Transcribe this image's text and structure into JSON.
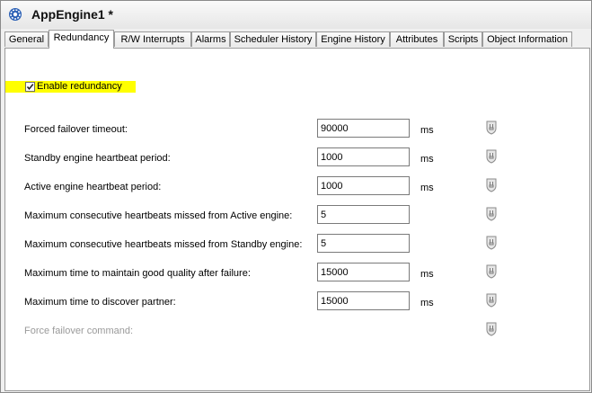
{
  "window": {
    "title": "AppEngine1 *",
    "icon": "engine-gear-icon"
  },
  "tabs": [
    {
      "label": "General",
      "active": false
    },
    {
      "label": "Redundancy",
      "active": true
    },
    {
      "label": "R/W Interrupts",
      "active": false
    },
    {
      "label": "Alarms",
      "active": false
    },
    {
      "label": "Scheduler History",
      "active": false
    },
    {
      "label": "Engine History",
      "active": false
    },
    {
      "label": "Attributes",
      "active": false
    },
    {
      "label": "Scripts",
      "active": false
    },
    {
      "label": "Object Information",
      "active": false
    }
  ],
  "redundancy": {
    "enable_label": "Enable redundancy",
    "enable_checked": true,
    "highlight_color": "#ffff00",
    "fields": [
      {
        "label": "Forced failover timeout:",
        "value": "90000",
        "unit": "ms",
        "lock": "lock-icon"
      },
      {
        "label": "Standby engine heartbeat period:",
        "value": "1000",
        "unit": "ms",
        "lock": "lock-icon"
      },
      {
        "label": "Active engine heartbeat period:",
        "value": "1000",
        "unit": "ms",
        "lock": "lock-icon"
      },
      {
        "label": "Maximum consecutive heartbeats missed from Active engine:",
        "value": "5",
        "unit": "",
        "lock": "lock-icon"
      },
      {
        "label": "Maximum consecutive heartbeats missed from Standby engine:",
        "value": "5",
        "unit": "",
        "lock": "lock-icon"
      },
      {
        "label": "Maximum time to maintain good quality after failure:",
        "value": "15000",
        "unit": "ms",
        "lock": "lock-icon"
      },
      {
        "label": "Maximum time to discover partner:",
        "value": "15000",
        "unit": "ms",
        "lock": "lock-icon"
      }
    ],
    "command": {
      "label": "Force failover command:",
      "lock": "lock-icon"
    }
  }
}
